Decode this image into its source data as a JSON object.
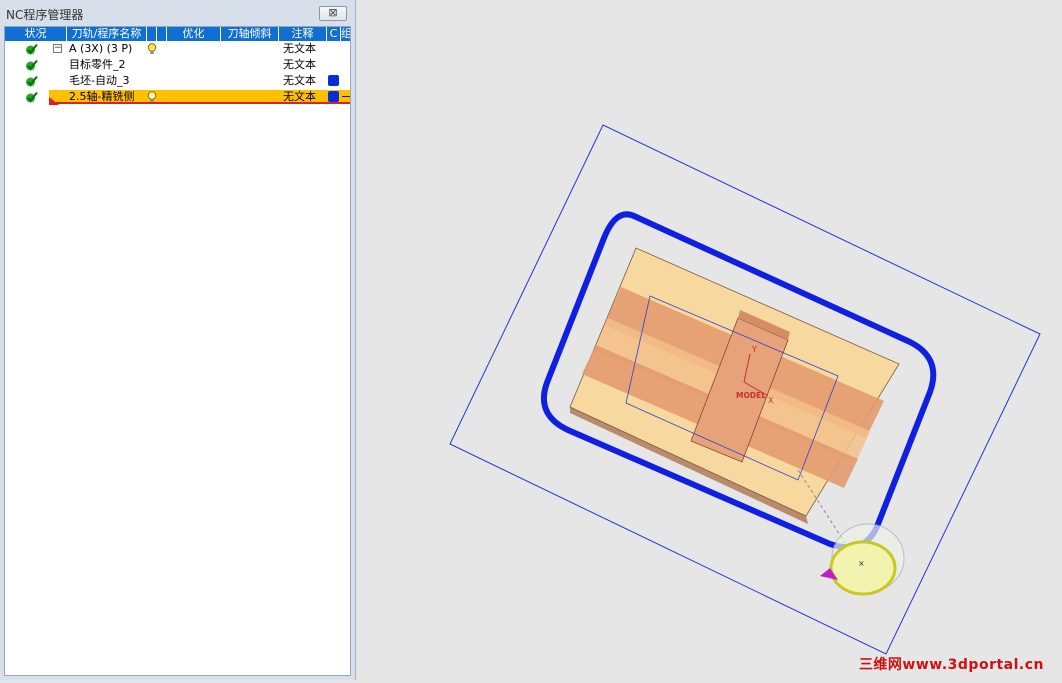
{
  "panel": {
    "title": "NC程序管理器",
    "close_label": "⊠"
  },
  "columns": [
    {
      "key": "status",
      "label": "状况"
    },
    {
      "key": "name",
      "label": "刀轨/程序名称"
    },
    {
      "key": "c1",
      "label": ""
    },
    {
      "key": "c2",
      "label": ""
    },
    {
      "key": "optimize",
      "label": "优化"
    },
    {
      "key": "tilt",
      "label": "刀轴倾斜"
    },
    {
      "key": "note",
      "label": "注释"
    },
    {
      "key": "c",
      "label": "C"
    },
    {
      "key": "extra",
      "label": "组"
    }
  ],
  "rows": [
    {
      "name": "A (3X) (3 P)",
      "note": "无文本",
      "expand": "−",
      "bulb": true,
      "swatch": false,
      "selected": false
    },
    {
      "name": "目标零件_2",
      "note": "无文本",
      "expand": "",
      "bulb": false,
      "swatch": false,
      "selected": false
    },
    {
      "name": "毛坯-自动_3",
      "note": "无文本",
      "expand": "",
      "bulb": false,
      "swatch": true,
      "selected": false
    },
    {
      "name": "2.5轴-精铣侧",
      "note": "无文本",
      "expand": "",
      "bulb": true,
      "swatch": true,
      "selected": true
    }
  ],
  "viewport": {
    "axis_y": "Y",
    "axis_x": "X",
    "model_label": "MODEL",
    "watermark": "三维网www.3dportal.cn"
  },
  "colors": {
    "header": "#0f6fd2",
    "selection": "#ffc000",
    "toolpath": "#1020e0",
    "part_light": "#f7d9a0",
    "part_band": "#e39a70"
  }
}
